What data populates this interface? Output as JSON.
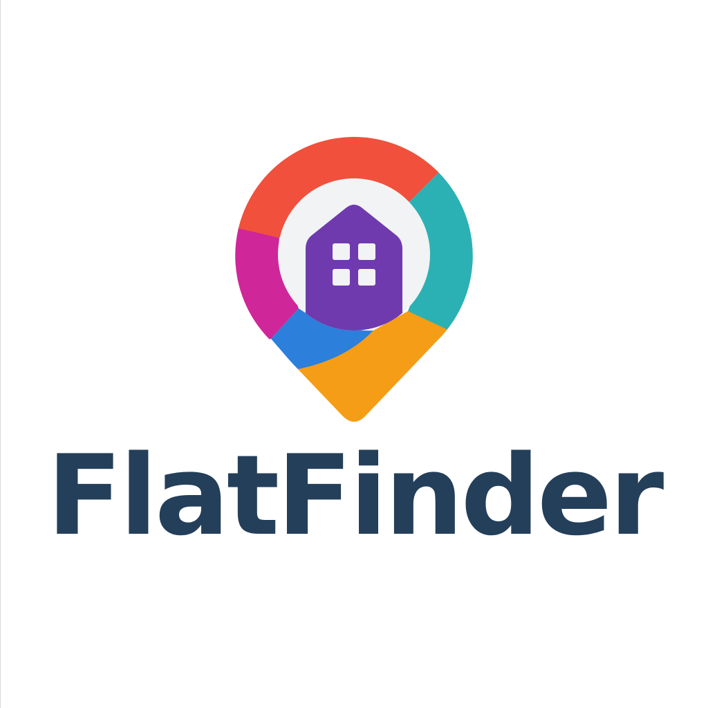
{
  "brand": {
    "name": "FlatFinder"
  },
  "colors": {
    "background": "#ffffff",
    "wordmark": "#243f5a",
    "segment_red": "#f0503c",
    "segment_teal": "#2bb1b4",
    "segment_magenta": "#cf2699",
    "segment_blue": "#2c7fdb",
    "segment_orange": "#f59d16",
    "inner_circle": "#f2f3f4",
    "house": "#6f3aae",
    "windows": "#f2f3f4"
  },
  "icons": {
    "logo": "location-pin-with-house-icon"
  }
}
